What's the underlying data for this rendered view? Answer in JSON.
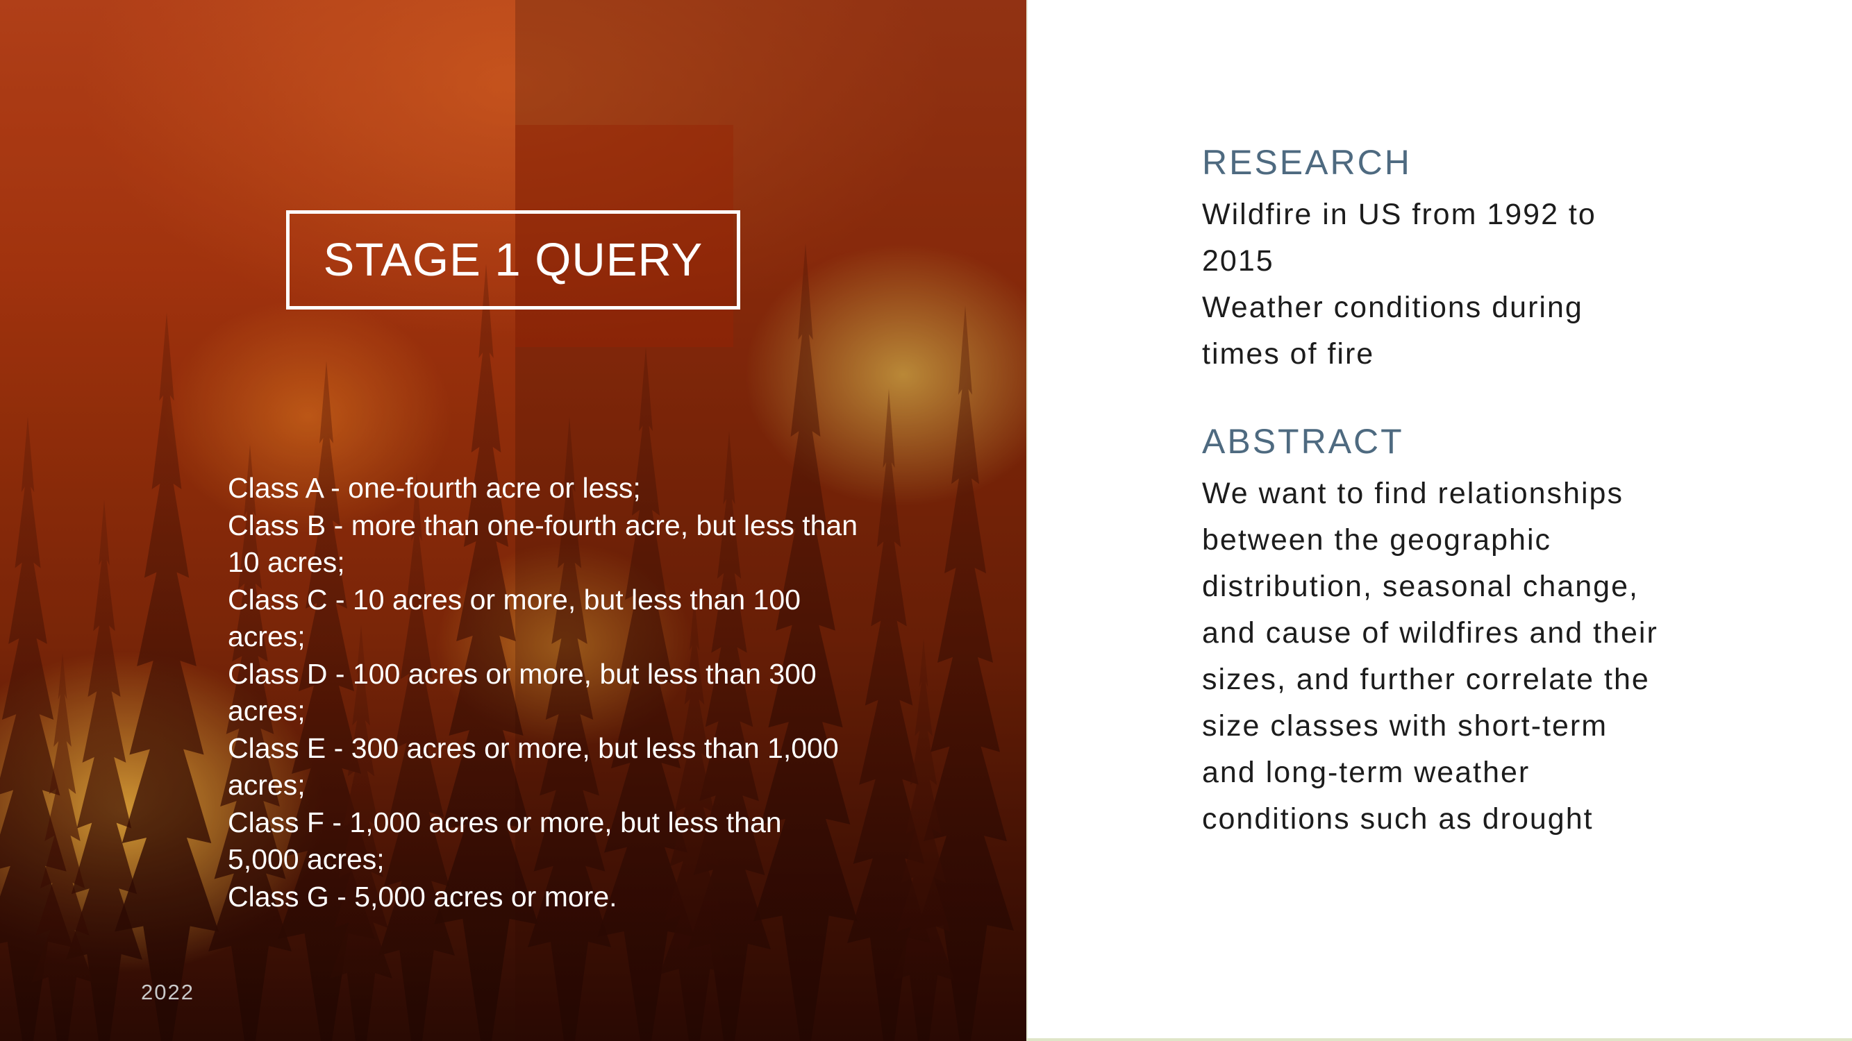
{
  "title": "STAGE 1 QUERY",
  "classes": [
    [
      "Class A - one-fourth acre or less;"
    ],
    [
      "Class B - more than one-fourth acre, but less than",
      "10 acres;"
    ],
    [
      "Class C - 10 acres or more, but less than 100",
      "acres;"
    ],
    [
      "Class D - 100 acres or more, but less than 300",
      "acres;"
    ],
    [
      "Class E - 300 acres or more, but less than 1,000",
      "acres;"
    ],
    [
      "Class F - 1,000 acres or more, but less than",
      "5,000 acres;"
    ],
    [
      "Class G - 5,000 acres or more."
    ]
  ],
  "year": "2022",
  "research": {
    "heading": "RESEARCH",
    "lines": [
      "Wildfire in US from 1992 to",
      "2015",
      "Weather conditions during",
      "times of fire"
    ]
  },
  "abstract": {
    "heading": "ABSTRACT",
    "lines": [
      "We want to find relationships",
      "between the geographic",
      "distribution, seasonal change,",
      "and cause of wildfires and their",
      "sizes, and further correlate the",
      "size classes with short-term",
      "and long-term weather",
      "conditions such as drought"
    ]
  }
}
